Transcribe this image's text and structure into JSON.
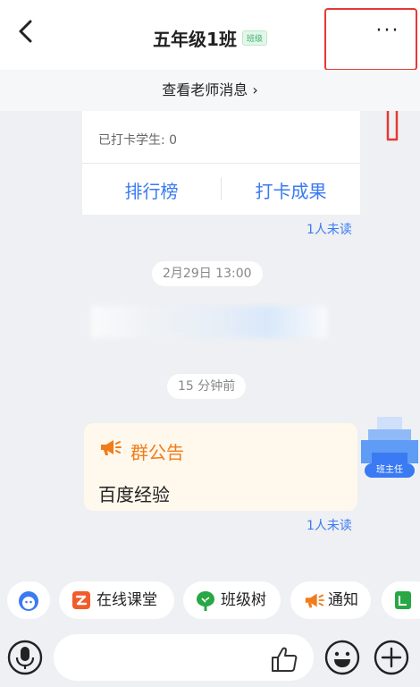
{
  "header": {
    "title": "五年级1班",
    "title_badge": "班级",
    "more_label": "···"
  },
  "teacher_bar": {
    "label": "查看老师消息 ›"
  },
  "card": {
    "checked_in": "已打卡学生: 0",
    "rank_label": "排行榜",
    "result_label": "打卡成果"
  },
  "unread_1": "1人未读",
  "time_1": "2月29日 13:00",
  "time_2": "15 分钟前",
  "avatar_tag": "班主任",
  "announcement": {
    "title": "群公告",
    "body": "百度经验"
  },
  "unread_2": "1人未读",
  "quick_chips": [
    {
      "icon": "assistant-icon",
      "label": ""
    },
    {
      "icon": "online-class-icon",
      "label": "在线课堂"
    },
    {
      "icon": "class-tree-icon",
      "label": "班级树"
    },
    {
      "icon": "megaphone-icon",
      "label": "通知"
    },
    {
      "icon": "book-icon",
      "label": ""
    }
  ],
  "colors": {
    "accent_blue": "#3a7af3",
    "announcement_orange": "#f07c1a",
    "highlight_red": "#e53935"
  }
}
